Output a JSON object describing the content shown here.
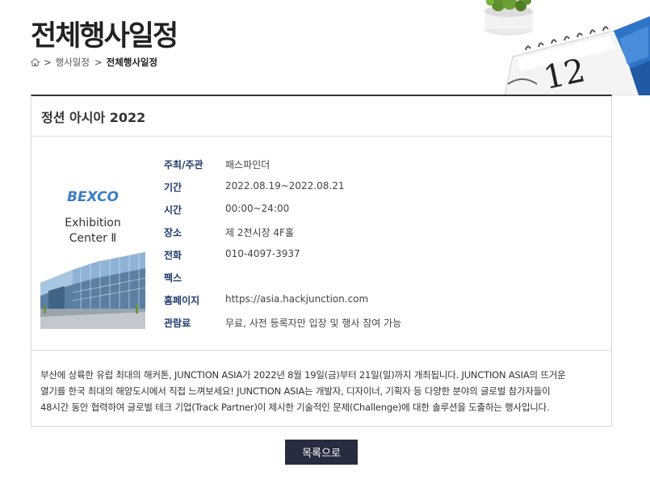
{
  "header": {
    "title": "전체행사일정",
    "breadcrumb": {
      "separator": ">",
      "items": [
        "행사일정",
        "전체행사일정"
      ]
    },
    "calendar_day": "12"
  },
  "event": {
    "name": "정션 아시아 2022",
    "poster": {
      "brand": "BEXCO",
      "line1": "Exhibition",
      "line2": "Center Ⅱ"
    },
    "fields": [
      {
        "label": "주최/주관",
        "value": "패스파인더"
      },
      {
        "label": "기간",
        "value": "2022.08.19~2022.08.21"
      },
      {
        "label": "시간",
        "value": "00:00~24:00"
      },
      {
        "label": "장소",
        "value": "제 2전시장 4F홀"
      },
      {
        "label": "전화",
        "value": "010-4097-3937"
      },
      {
        "label": "팩스",
        "value": ""
      },
      {
        "label": "홈페이지",
        "value": "https://asia.hackjunction.com"
      },
      {
        "label": "관람료",
        "value": "무료, 사전 등록자만 입장 및 행사 참여 가능"
      }
    ],
    "description_lines": [
      "부산에 상륙한 유럽 최대의 해커톤, JUNCTION ASIA가 2022년 8월 19일(금)부터 21일(일)까지 개최됩니다. JUNCTION ASIA의 뜨거운",
      "열기를 한국 최대의 해양도시에서 직접 느껴보세요! JUNCTION ASIA는 개발자, 디자이너, 기획자 등 다양한 분야의 글로벌 참가자들이",
      "48시간 동안 협력하여 글로벌 테크 기업(Track Partner)이 제시한 기술적인 문제(Challenge)에 대한 솔루션을 도출하는 행사입니다."
    ]
  },
  "actions": {
    "list_label": "목록으로"
  },
  "colors": {
    "label_navy": "#1d3a6b",
    "button_bg": "#272c3f",
    "calendar_blue": "#2d74c8"
  }
}
